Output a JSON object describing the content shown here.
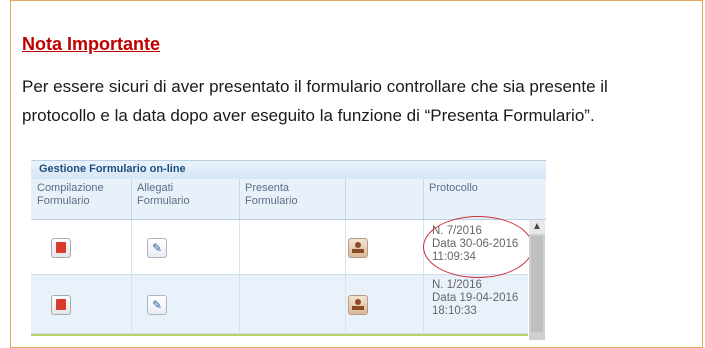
{
  "note": {
    "title": "Nota Importante",
    "body": "Per essere sicuri di aver presentato il formulario controllare che sia presente il protocollo e la data dopo aver eseguito la funzione di “Presenta Formulario”."
  },
  "grid": {
    "title": "Gestione Formulario on-line",
    "columns": [
      {
        "label": "Compilazione Formulario"
      },
      {
        "label": "Allegati Formulario"
      },
      {
        "label": "Presenta Formulario"
      },
      {
        "label": ""
      },
      {
        "label": "Protocollo"
      }
    ],
    "rows": [
      {
        "protocol_number": "N. 7/2016",
        "protocol_date": "Data 30-06-2016",
        "protocol_time": "11:09:34",
        "highlighted": true
      },
      {
        "protocol_number": "N. 1/2016",
        "protocol_date": "Data 19-04-2016",
        "protocol_time": "18:10:33",
        "highlighted": false
      }
    ]
  },
  "icons": {
    "form": "pdf-form-icon",
    "attachments": "paperclip-icon",
    "submit": "stamp-icon"
  },
  "colors": {
    "title_red": "#c00000",
    "highlight_ellipse": "#c8323a",
    "header_blue": "#1f4f80"
  }
}
